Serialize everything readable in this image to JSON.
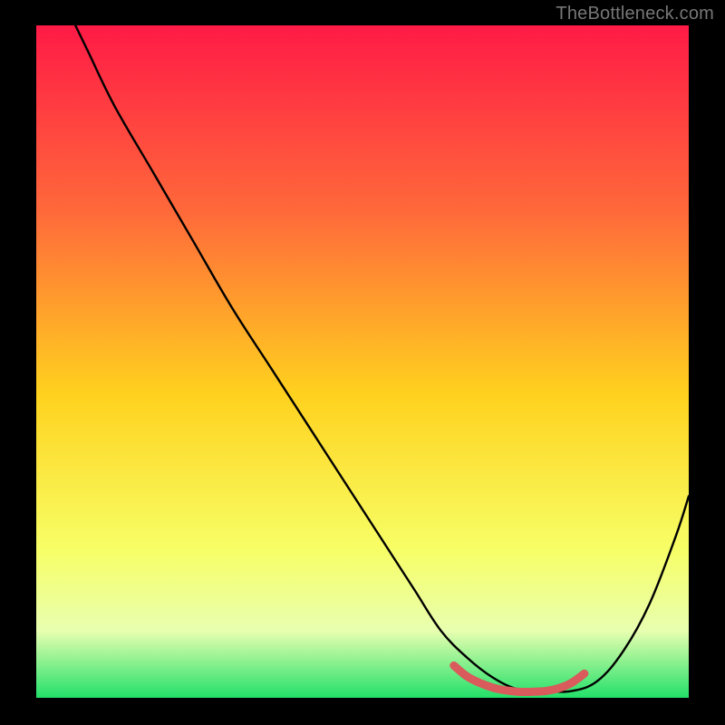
{
  "watermark": "TheBottleneck.com",
  "colors": {
    "background": "#000000",
    "gradient_top": "#ff1a46",
    "gradient_mid_upper": "#ff6a3a",
    "gradient_mid": "#ffd21e",
    "gradient_low": "#f7ff66",
    "gradient_pale": "#e8ffb0",
    "gradient_bottom": "#22e06a",
    "curve": "#000000",
    "trough": "#d95b5b"
  },
  "chart_data": {
    "type": "line",
    "title": "",
    "xlabel": "",
    "ylabel": "",
    "xlim": [
      0,
      100
    ],
    "ylim": [
      0,
      100
    ],
    "series": [
      {
        "name": "curve",
        "x": [
          6,
          8,
          12,
          18,
          24,
          30,
          36,
          42,
          48,
          54,
          58,
          62,
          66,
          70,
          74,
          78,
          82,
          86,
          90,
          94,
          98,
          100
        ],
        "y": [
          100,
          96,
          88,
          78,
          68,
          58,
          49,
          40,
          31,
          22,
          16,
          10,
          6,
          3,
          1.2,
          1,
          1,
          2.5,
          7,
          14,
          24,
          30
        ]
      }
    ],
    "highlight": {
      "name": "trough-band",
      "x": [
        64,
        66,
        68,
        70,
        72,
        74,
        76,
        78,
        80,
        82,
        84
      ],
      "y": [
        4.8,
        3.2,
        2.2,
        1.5,
        1.1,
        0.9,
        0.9,
        1.0,
        1.4,
        2.2,
        3.6
      ]
    }
  }
}
